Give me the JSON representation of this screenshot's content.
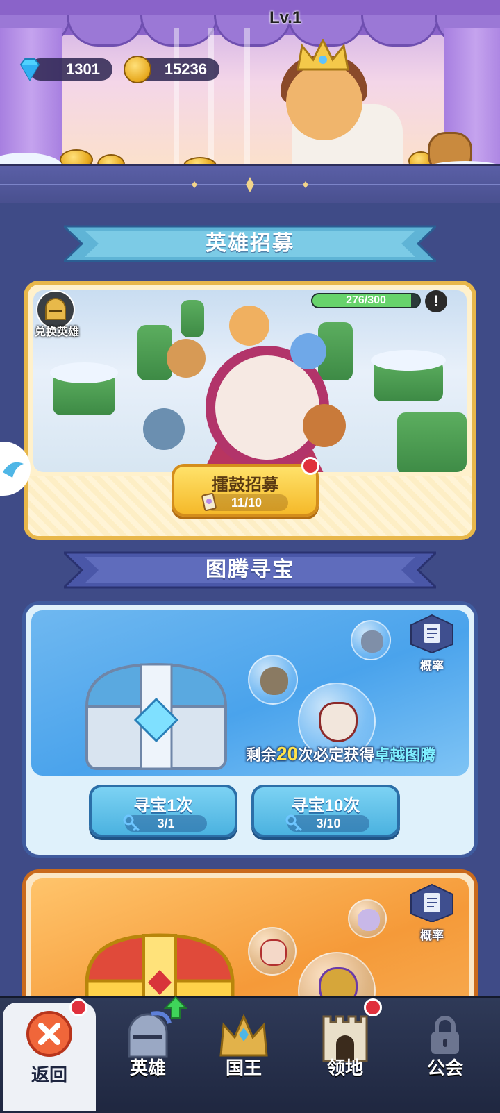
{
  "currency": {
    "gems": "1301",
    "gold": "15236"
  },
  "recruit": {
    "section_title": "英雄招募",
    "exchange_label": "兑换英雄",
    "level_label": "Lv.1",
    "level_progress_text": "276/300",
    "level_progress_fraction": 0.92,
    "alert_glyph": "!",
    "drum_button_label": "擂鼓招募",
    "drum_count": "11/10"
  },
  "totem": {
    "section_title": "图腾寻宝",
    "probability_label": "概率",
    "remain_prefix": "剩余",
    "remain_number": "20",
    "remain_middle": "次必定获得",
    "remain_highlight": "卓越图腾",
    "seek_once_label": "寻宝1次",
    "seek_once_count": "3/1",
    "seek_ten_label": "寻宝10次",
    "seek_ten_count": "3/10"
  },
  "totem2": {
    "probability_label": "概率"
  },
  "nav": {
    "back": "返回",
    "heroes": "英雄",
    "king": "国王",
    "territory": "领地",
    "guild": "公会"
  },
  "colors": {
    "accent_blue": "#4aa3ec",
    "accent_gold": "#f5b92a",
    "badge_red": "#e0303c",
    "progress_green": "#67d36c"
  },
  "icons": [
    "gem-icon",
    "gold-coin-icon",
    "helmet-icon",
    "alert-icon",
    "scroll-icon",
    "key-icon",
    "probability-list-icon",
    "close-icon",
    "knight-helmet-icon",
    "crown-icon",
    "castle-icon",
    "lock-icon",
    "upgrade-arrow-icon"
  ]
}
